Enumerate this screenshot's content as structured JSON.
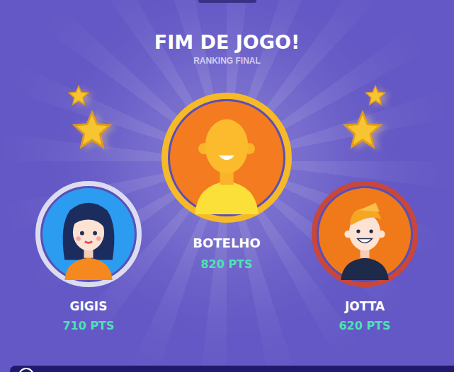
{
  "title": "FIM DE JOGO!",
  "subtitle": "RANKING FINAL",
  "players": [
    {
      "name": "BOTELHO",
      "score": "820 PTS",
      "kind": "bald",
      "color": "#f6b928"
    },
    {
      "name": "GIGIS",
      "score": "710 PTS",
      "kind": "girl",
      "color": "#dcdcf0"
    },
    {
      "name": "JOTTA",
      "score": "620 PTS",
      "kind": "boy",
      "color": "#c9473a"
    }
  ]
}
